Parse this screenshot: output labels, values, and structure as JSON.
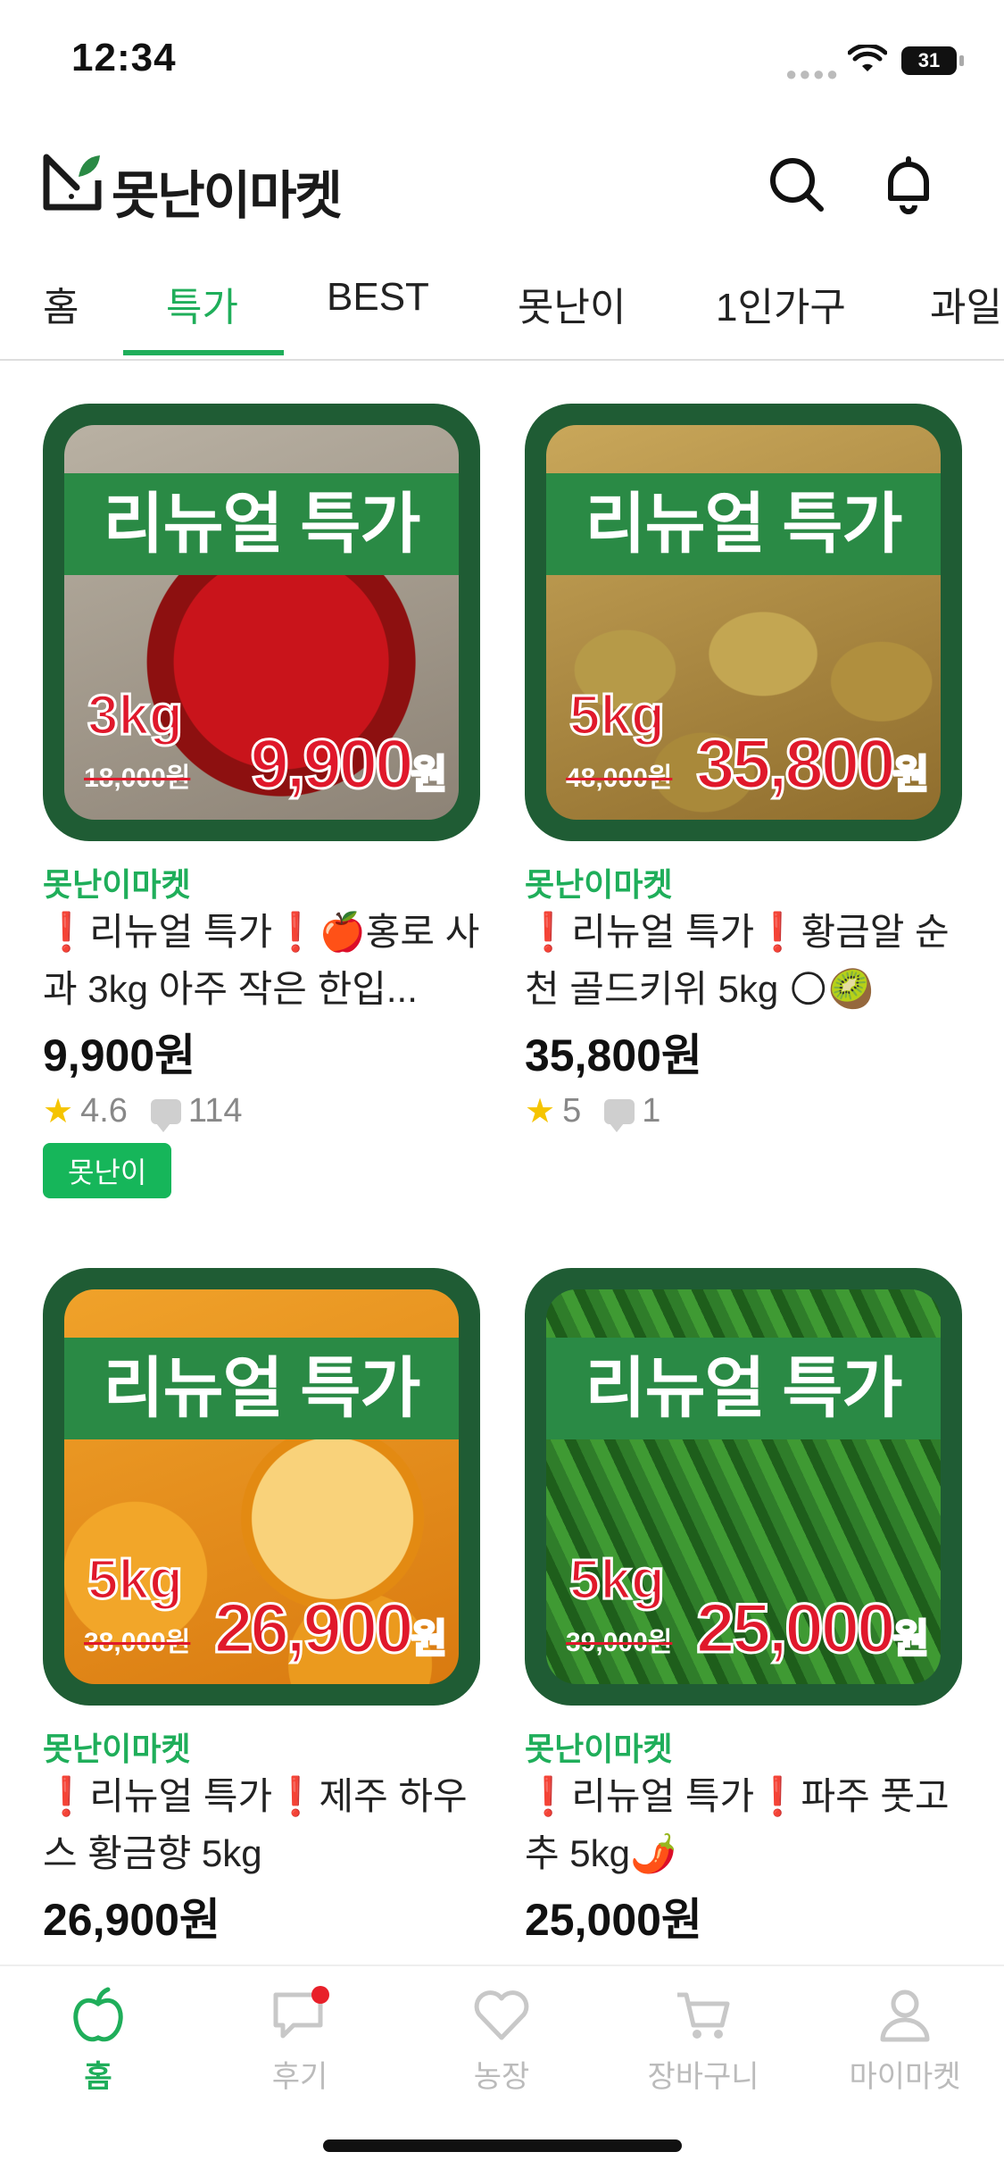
{
  "status_bar": {
    "time": "12:34",
    "battery": "31"
  },
  "header": {
    "app_name": "못난이마켓"
  },
  "tabs": [
    {
      "label": "홈"
    },
    {
      "label": "특가",
      "active": true
    },
    {
      "label": "BEST"
    },
    {
      "label": "못난이"
    },
    {
      "label": "1인가구"
    },
    {
      "label": "과일"
    }
  ],
  "products": [
    {
      "seller": "못난이마켓",
      "title": "❗리뉴얼 특가❗🍎홍로 사과 3kg 아주 작은 한입...",
      "price": "9,900원",
      "rating": "4.6",
      "reviews": "114",
      "tag": "못난이",
      "banner": "리뉴얼 특가",
      "weight": "3kg",
      "old_price": "18,000원",
      "sale_price": "9,900",
      "sale_unit": "원",
      "colors": {
        "bg1": "#b9b1a3",
        "bg2": "#8d8376",
        "fruit": "#c9141b"
      }
    },
    {
      "seller": "못난이마켓",
      "title": "❗리뉴얼 특가❗황금알 순천 골드키위 5kg 🌕🥝",
      "price": "35,800원",
      "rating": "5",
      "reviews": "1",
      "banner": "리뉴얼 특가",
      "weight": "5kg",
      "old_price": "48,000원",
      "sale_price": "35,800",
      "sale_unit": "원",
      "colors": {
        "bg1": "#c9a75a",
        "bg2": "#8f6d2d",
        "fruit": "#a88734"
      }
    },
    {
      "seller": "못난이마켓",
      "title": "❗리뉴얼 특가❗제주 하우스 황금향 5kg",
      "price": "26,900원",
      "banner": "리뉴얼 특가",
      "weight": "5kg",
      "old_price": "38,000원",
      "sale_price": "26,900",
      "sale_unit": "원",
      "colors": {
        "bg1": "#f0a22a",
        "bg2": "#d97a10",
        "fruit": "#f6b84a"
      }
    },
    {
      "seller": "못난이마켓",
      "title": "❗리뉴얼 특가❗파주 풋고추 5kg🌶️",
      "price": "25,000원",
      "banner": "리뉴얼 특가",
      "weight": "5kg",
      "old_price": "39,000원",
      "sale_price": "25,000",
      "sale_unit": "원",
      "colors": {
        "bg1": "#2f7d2a",
        "bg2": "#174c17",
        "fruit": "#3f9a33"
      }
    }
  ],
  "tabbar": [
    {
      "label": "홈",
      "icon": "apple-icon",
      "active": true
    },
    {
      "label": "후기",
      "icon": "chat-icon"
    },
    {
      "label": "농장",
      "icon": "heart-icon"
    },
    {
      "label": "장바구니",
      "icon": "cart-icon"
    },
    {
      "label": "마이마켓",
      "icon": "person-icon"
    }
  ],
  "accent": "#1fae5a"
}
